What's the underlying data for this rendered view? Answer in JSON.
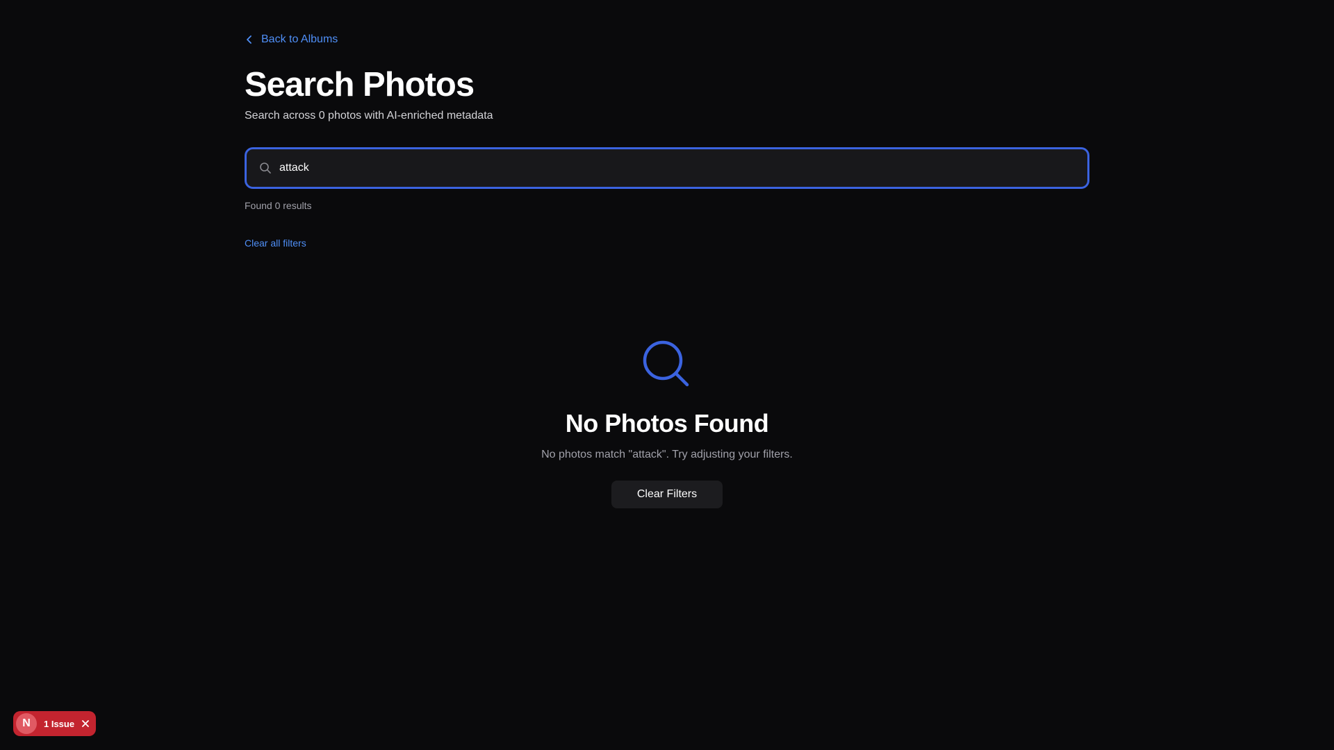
{
  "nav": {
    "back_label": "Back to Albums",
    "back_icon": "chevron-left-icon"
  },
  "header": {
    "title": "Search Photos",
    "subtitle": "Search across 0 photos with AI-enriched metadata"
  },
  "search": {
    "value": "attack",
    "icon": "search-icon",
    "results_text": "Found 0 results",
    "clear_all_label": "Clear all filters"
  },
  "empty_state": {
    "icon": "search-icon",
    "title": "No Photos Found",
    "description": "No photos match \"attack\". Try adjusting your filters.",
    "button_label": "Clear Filters"
  },
  "issue_badge": {
    "avatar_letter": "N",
    "label": "1 Issue",
    "close_icon": "close-icon"
  },
  "colors": {
    "background": "#0a0a0c",
    "accent": "#4f8ff7",
    "focus_border": "#3b63e0",
    "error": "#c3242f"
  }
}
